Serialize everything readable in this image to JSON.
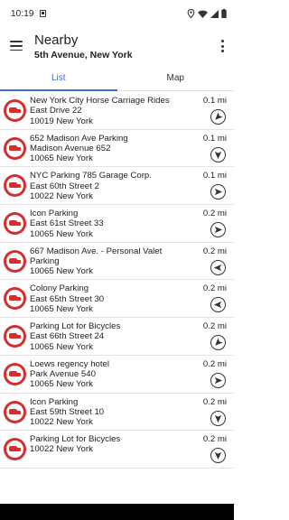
{
  "status": {
    "time": "10:19"
  },
  "header": {
    "title": "Nearby",
    "subtitle": "5th Avenue, New York"
  },
  "tabs": [
    {
      "label": "List"
    },
    {
      "label": "Map"
    }
  ],
  "items": [
    {
      "name": "New York City Horse Carriage Rides",
      "line2": "East Drive 22",
      "line3": "10019 New York",
      "distance": "0.1 mi",
      "bearing": 225
    },
    {
      "name": "652 Madison Ave Parking",
      "line2": "Madison Avenue 652",
      "line3": "10065 New York",
      "distance": "0.1 mi",
      "bearing": 180
    },
    {
      "name": "NYC Parking 785 Garage Corp.",
      "line2": "East 60th Street 2",
      "line3": "10022 New York",
      "distance": "0.1 mi",
      "bearing": 90
    },
    {
      "name": "Icon Parking",
      "line2": "East 61st Street 33",
      "line3": "10065 New York",
      "distance": "0.2 mi",
      "bearing": 90
    },
    {
      "name": "667 Madison Ave. - Personal Valet",
      "line2": "Parking",
      "line3": "10065 New York",
      "distance": "0.2 mi",
      "bearing": 270
    },
    {
      "name": "Colony Parking",
      "line2": "East 65th Street 30",
      "line3": "10065 New York",
      "distance": "0.2 mi",
      "bearing": 270
    },
    {
      "name": "Parking Lot for Bicycles",
      "line2": "East 66th Street 24",
      "line3": "10065 New York",
      "distance": "0.2 mi",
      "bearing": 225
    },
    {
      "name": "Loews regency hotel",
      "line2": "Park Avenue 540",
      "line3": "10065 New York",
      "distance": "0.2 mi",
      "bearing": 90
    },
    {
      "name": "Icon Parking",
      "line2": "East 59th Street 10",
      "line3": "10022 New York",
      "distance": "0.2 mi",
      "bearing": 180
    },
    {
      "name": "Parking Lot for Bicycles",
      "line2": "10022 New York",
      "line3": "",
      "distance": "0.2 mi",
      "bearing": 180
    }
  ]
}
